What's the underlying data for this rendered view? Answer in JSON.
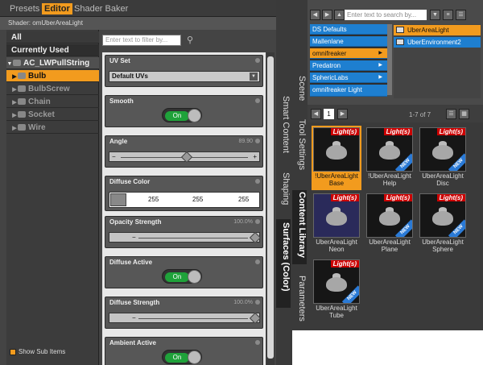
{
  "left_tabs": {
    "presets": "Presets",
    "editor": "Editor",
    "shader_baker": "Shader Baker"
  },
  "shader_line": "Shader: omUberAreaLight",
  "tree": {
    "all": "All",
    "currently_used": "Currently Used",
    "figure": "AC_LWPullString",
    "items": [
      "Bulb",
      "BulbScrew",
      "Chain",
      "Socket",
      "Wire"
    ]
  },
  "show_sub_items": "Show Sub Items",
  "filter_placeholder": "Enter text to filter by...",
  "properties": {
    "uv_set": {
      "label": "UV Set",
      "value": "Default UVs"
    },
    "smooth": {
      "label": "Smooth",
      "value": "On"
    },
    "angle": {
      "label": "Angle",
      "value": "89.90"
    },
    "diffuse_color": {
      "label": "Diffuse Color",
      "r": "255",
      "g": "255",
      "b": "255"
    },
    "opacity_strength": {
      "label": "Opacity Strength",
      "value": "100.0%",
      "level": 1.0
    },
    "diffuse_active": {
      "label": "Diffuse Active",
      "value": "On"
    },
    "diffuse_strength": {
      "label": "Diffuse Strength",
      "value": "100.0%",
      "level": 1.0
    },
    "ambient_active": {
      "label": "Ambient Active",
      "value": "On"
    }
  },
  "vertical_tabs": [
    "Smart Content",
    "Shaping",
    "Surfaces (Color)"
  ],
  "right_vertical_tabs": [
    "Scene",
    "Tool Settings",
    "Content Library",
    "Parameters"
  ],
  "content_library": {
    "search_placeholder": "Enter text to search by...",
    "ds_list": [
      "DS Defaults",
      "Mallenlane",
      "omnifreaker",
      "Predatron",
      "SphericLabs",
      "omnifreaker Light"
    ],
    "preset_list": [
      "UberAreaLight",
      "UberEnvironment2"
    ],
    "page_value": "1",
    "page_of": "1-7 of 7",
    "items": [
      {
        "label": "!UberAreaLight Base",
        "badge": "Light(s)",
        "new": false
      },
      {
        "label": "!UberAreaLight Help",
        "badge": "Light(s)",
        "new": true
      },
      {
        "label": "UberAreaLight Disc",
        "badge": "Light(s)",
        "new": true
      },
      {
        "label": "UberAreaLight Neon",
        "badge": "Light(s)",
        "new": false
      },
      {
        "label": "UberAreaLight Plane",
        "badge": "Light(s)",
        "new": true
      },
      {
        "label": "UberAreaLight Sphere",
        "badge": "Light(s)",
        "new": true
      },
      {
        "label": "UberAreaLight Tube",
        "badge": "Light(s)",
        "new": true
      }
    ],
    "new_tag": "NEW"
  },
  "colors": {
    "accent": "#f29b1e",
    "toggle_on": "#1fa23a",
    "select_blue": "#1e7fd0",
    "badge_red": "#cc0000"
  }
}
